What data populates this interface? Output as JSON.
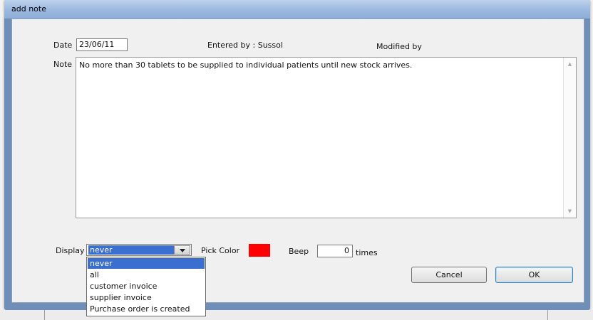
{
  "window": {
    "title": "add note"
  },
  "header": {
    "date_label": "Date",
    "date_value": "23/06/11",
    "entered_by": "Entered by : Sussol",
    "modified_by": "Modified by"
  },
  "note": {
    "label": "Note",
    "text": "No more than 30 tablets to be supplied to individual patients until new stock arrives."
  },
  "display": {
    "label": "Display",
    "selected": "never",
    "options": [
      "never",
      "all",
      "customer invoice",
      "supplier invoice",
      "Purchase order is created"
    ]
  },
  "color": {
    "label": "Pick Color",
    "value": "#ff0000"
  },
  "beep": {
    "label": "Beep",
    "value": "0",
    "suffix": "times"
  },
  "buttons": {
    "cancel": "Cancel",
    "ok": "OK"
  },
  "icons": {
    "scroll_up": "scroll-up-arrow",
    "scroll_down": "scroll-down-arrow",
    "combo": "chevron-down"
  }
}
